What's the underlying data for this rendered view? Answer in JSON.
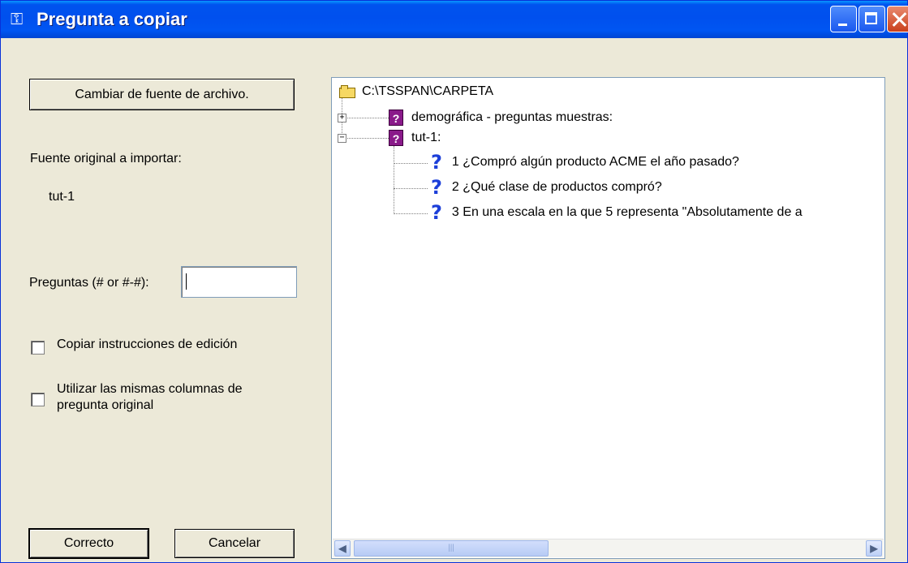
{
  "window": {
    "title": "Pregunta a copiar",
    "title_icon": "key-person-icon"
  },
  "left_panel": {
    "change_source_button": "Cambiar de fuente de archivo.",
    "source_label": "Fuente original a importar:",
    "source_value": "tut-1",
    "questions_label": "Preguntas (# or #-#):",
    "questions_value": "",
    "copy_edit_checkbox": {
      "label": "Copiar instrucciones de edición",
      "checked": false
    },
    "same_columns_checkbox": {
      "label": "Utilizar las mismas columnas de pregunta original",
      "checked": false
    },
    "ok_button": "Correcto",
    "cancel_button": "Cancelar"
  },
  "tree": {
    "root": {
      "label": "C:\\TSSPAN\\CARPETA",
      "icon": "folder-icon"
    },
    "nodes": [
      {
        "label": "demográfica - preguntas muestras:",
        "icon": "questionnaire-icon",
        "expander": "+"
      },
      {
        "label": "tut-1:",
        "icon": "questionnaire-icon",
        "expander": "−",
        "children": [
          {
            "label": "1  ¿Compró algún producto ACME el año pasado?",
            "icon": "question-icon"
          },
          {
            "label": "2  ¿Qué clase de productos compró?",
            "icon": "question-icon"
          },
          {
            "label": "3  En una escala en la que 5 representa \"Absolutamente de a",
            "icon": "question-icon"
          }
        ]
      }
    ]
  }
}
